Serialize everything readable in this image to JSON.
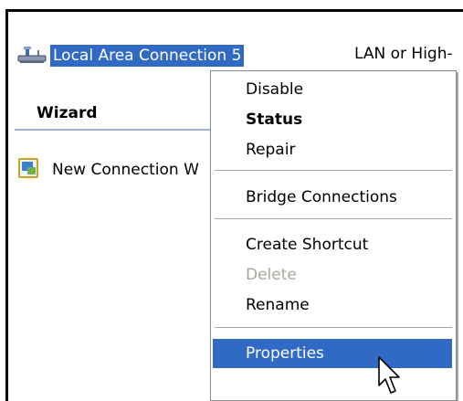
{
  "connection": {
    "name": "Local Area Connection 5",
    "type_text": "LAN or High-"
  },
  "section": {
    "title": "Wizard",
    "wizard_item": "New Connection W"
  },
  "context_menu": {
    "disable": "Disable",
    "status": "Status",
    "repair": "Repair",
    "bridge": "Bridge Connections",
    "shortcut": "Create Shortcut",
    "delete": "Delete",
    "rename": "Rename",
    "properties": "Properties"
  },
  "colors": {
    "selection": "#316ac5",
    "disabled_text": "#aca899",
    "rule": "#9bb3d6"
  },
  "icons": [
    "network-connection-icon",
    "new-connection-wizard-icon",
    "mouse-pointer-icon"
  ]
}
